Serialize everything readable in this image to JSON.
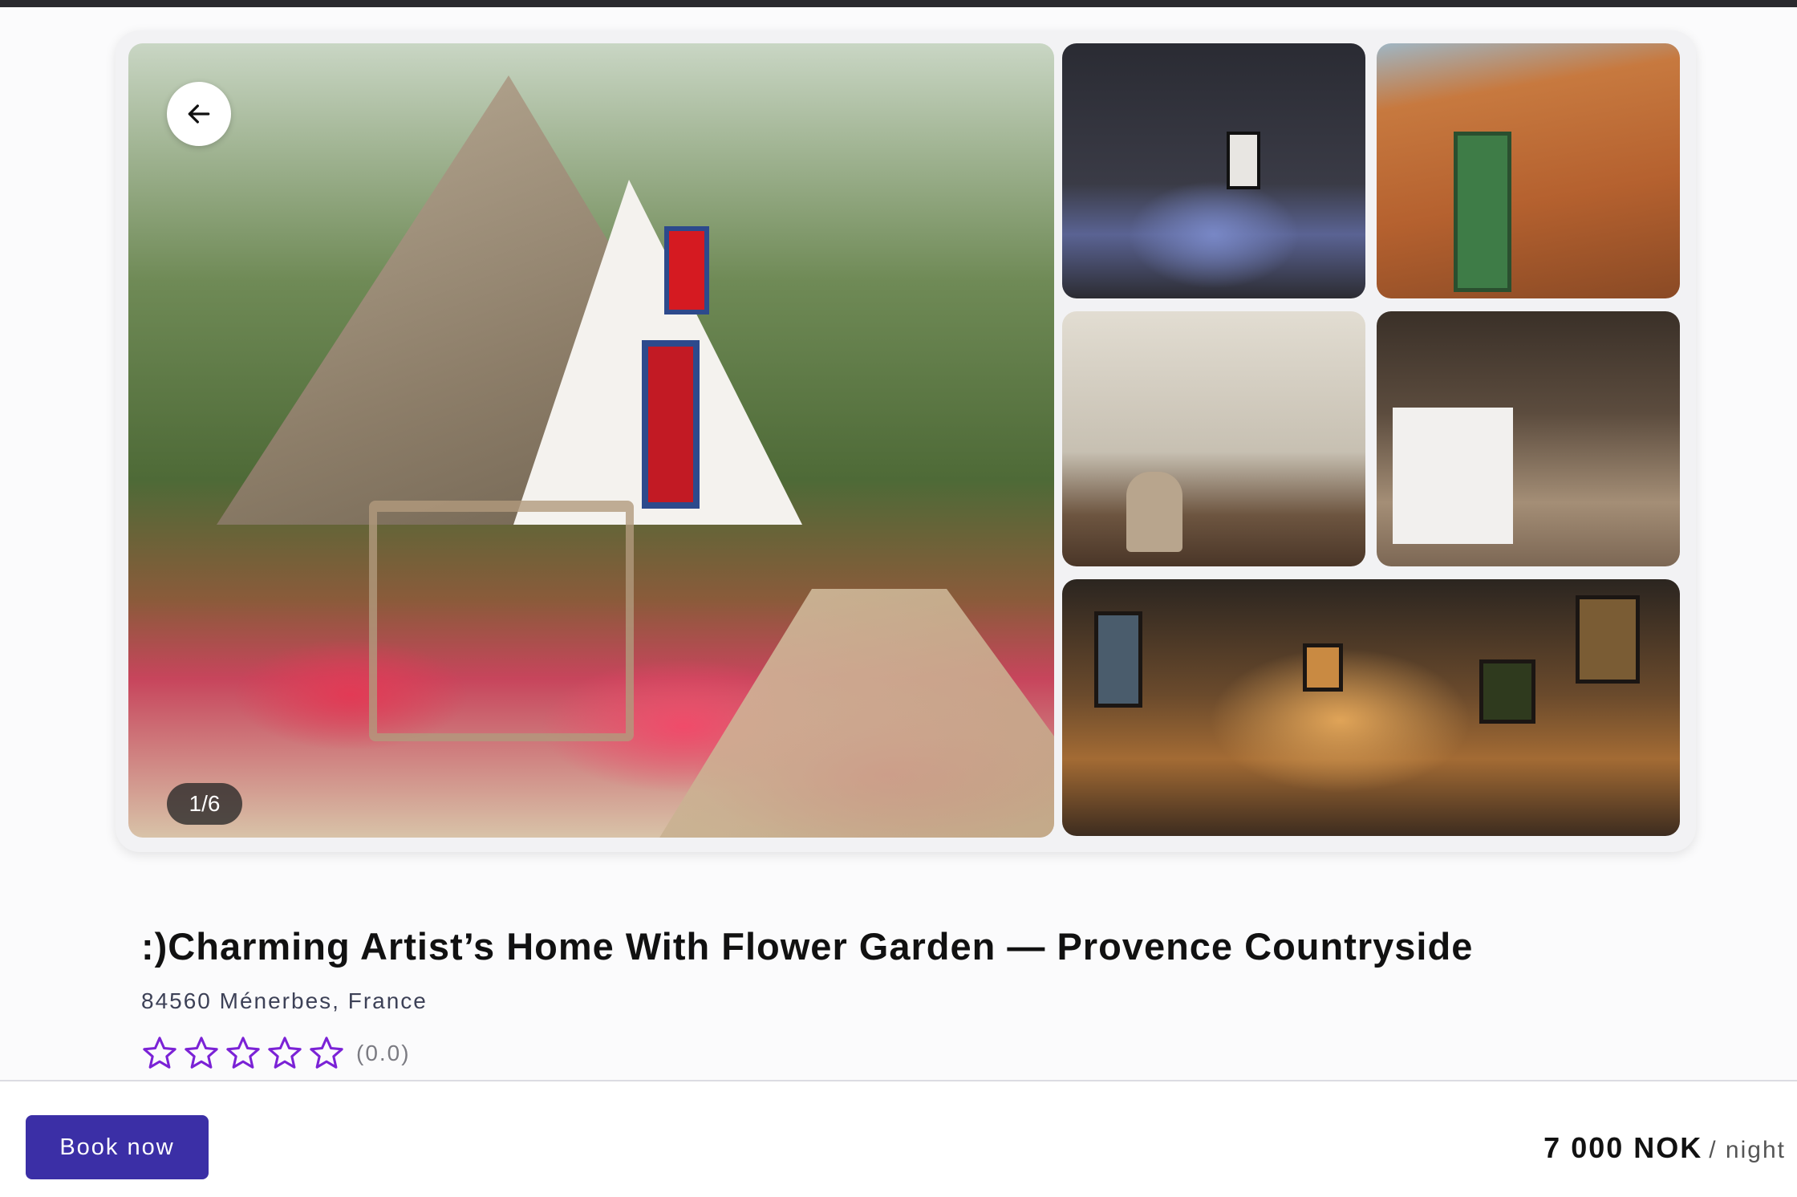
{
  "gallery": {
    "photo_counter": "1/6",
    "photos": [
      {
        "alt": "Thatched A-frame cottage with flower garden"
      },
      {
        "alt": "Dark modern bedroom"
      },
      {
        "alt": "Terracotta bathroom with green door"
      },
      {
        "alt": "Ornate classical salon"
      },
      {
        "alt": "Kitchen with white counter"
      },
      {
        "alt": "Art studio filled with paintings"
      }
    ]
  },
  "listing": {
    "title": ":)Charming Artist’s Home With Flower Garden — Provence Countryside",
    "address": "84560 Ménerbes, France",
    "rating_value": "(0.0)",
    "stars_filled": 0,
    "stars_total": 5,
    "star_color": "#7b22d6"
  },
  "booking": {
    "button_label": "Book now",
    "price": "7 000 NOK",
    "per_unit": "/ night",
    "button_color": "#3b2fa6"
  }
}
